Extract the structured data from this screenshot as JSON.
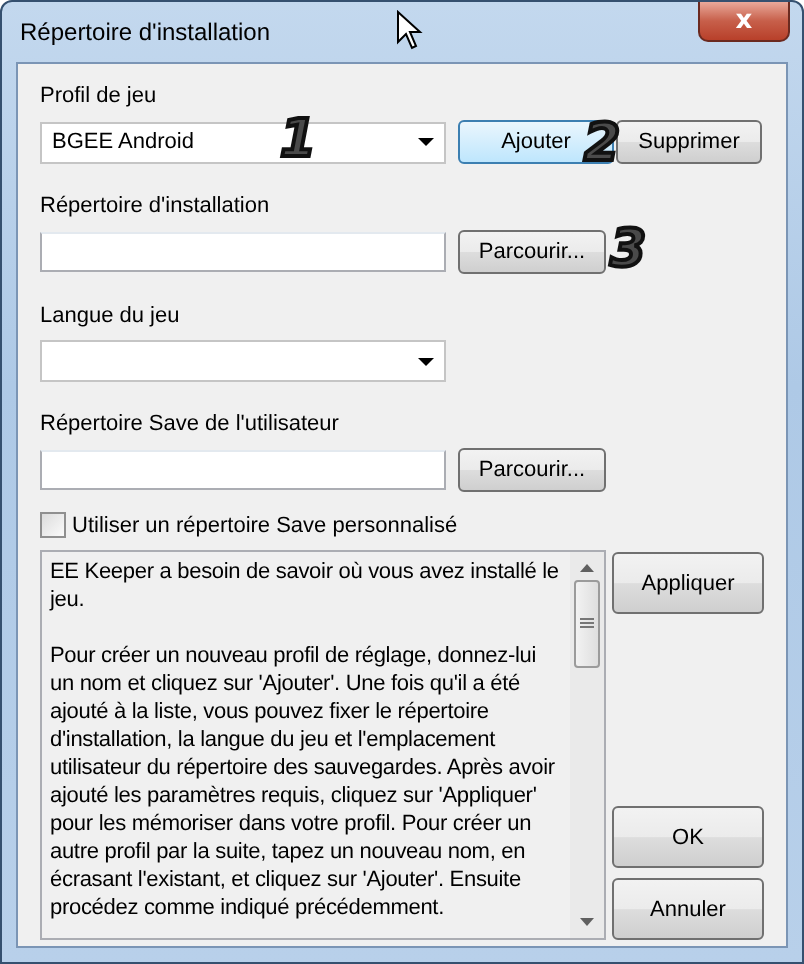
{
  "window": {
    "title": "Répertoire d'installation",
    "close_label": "x"
  },
  "profile": {
    "label": "Profil de jeu",
    "value": "BGEE Android",
    "buttons": [
      {
        "label": "Ajouter",
        "focused": true
      },
      {
        "label": "Supprimer",
        "focused": false
      }
    ]
  },
  "install_dir": {
    "label": "Répertoire d'installation",
    "browse": "Parcourir..."
  },
  "language": {
    "label": "Langue du jeu"
  },
  "save_dir": {
    "label": "Répertoire Save de l'utilisateur",
    "browse": "Parcourir..."
  },
  "custom_save": {
    "label": "Utiliser un répertoire Save personnalisé",
    "checked": false
  },
  "help_text": [
    "EE Keeper a besoin de savoir où vous avez installé le jeu.",
    "Pour créer un nouveau profil de réglage, donnez-lui un nom et cliquez sur 'Ajouter'. Une fois qu'il a été ajouté à la liste, vous pouvez fixer le répertoire d'installation, la langue du jeu et l'emplacement utilisateur du répertoire des sauvegardes. Après avoir ajouté les paramètres requis, cliquez sur 'Appliquer' pour les mémoriser dans votre profil. Pour créer un autre profil par la suite, tapez un nouveau nom, en écrasant l'existant, et cliquez sur 'Ajouter'. Ensuite procédez comme indiqué précédemment."
  ],
  "apply_button": "Appliquer",
  "dialog_buttons": [
    "OK",
    "Annuler"
  ],
  "annotations": [
    "1",
    "2",
    "3"
  ]
}
